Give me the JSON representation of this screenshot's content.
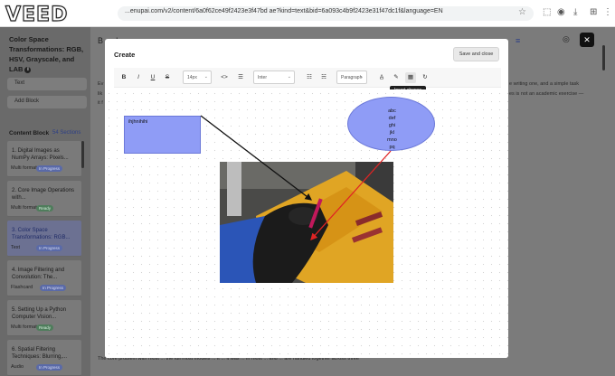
{
  "browser": {
    "logo": "VEED",
    "url": "...enupai.com/v2/content/6a0f62ce49f2423e3f47bd ae?kind=text&bid=6a093c4b9f2423e31f47dc1f&language=EN"
  },
  "left_panel": {
    "title": "Color Space Transformations: RGB, HSV, Grayscale, and LAB",
    "text_button": "Text",
    "add_block_button": "Add Block",
    "content_block_label": "Content Block",
    "sections_count": "54 Sections",
    "items": [
      {
        "title": "1. Digital Images as NumPy Arrays: Pixels...",
        "format": "Multi format",
        "status": "In Progress"
      },
      {
        "title": "2. Core Image Operations with...",
        "format": "Multi format",
        "status": "Ready"
      },
      {
        "title": "3. Color Space Transformations: RGB...",
        "format": "Text",
        "status": "In Progress"
      },
      {
        "title": "4. Image Filtering and Convolution: The...",
        "format": "Flashcard",
        "status": "In Progress"
      },
      {
        "title": "5. Setting Up a Python Computer Vision...",
        "format": "Multi format",
        "status": "Ready"
      },
      {
        "title": "6. Spatial Filtering Techniques: Blurring,...",
        "format": "Audio",
        "status": "In Progress"
      }
    ]
  },
  "background": {
    "editor_line_1": "Ev",
    "editor_line_2": "lik",
    "editor_line_3": "it f",
    "right_line_1": "e writing one, and a simple task",
    "right_line_2": "es is not an academic exercise —",
    "bottom_line": "The core problem with most ... the full most models ... it ... it was ... in most ... and ... are handled together across three"
  },
  "modal": {
    "title": "Create",
    "save_close": "Save and close",
    "toolbar": {
      "bold": "B",
      "italic": "I",
      "underline": "U",
      "strike": "S",
      "size_select": "14px",
      "code": "<>",
      "font_select": "Inter",
      "paragraph_select": "Paragraph"
    },
    "tooltip": "Insert shapes",
    "rect_text": "ihjhnihihi",
    "ellipse_lines": [
      "abc",
      "def",
      "ghi",
      "jkl",
      "mno",
      "pq"
    ]
  },
  "colors": {
    "shape_fill": "#8f9cf6",
    "accent": "#2d3f86",
    "ready": "#2e9e4f",
    "in_progress": "#5064c8"
  }
}
